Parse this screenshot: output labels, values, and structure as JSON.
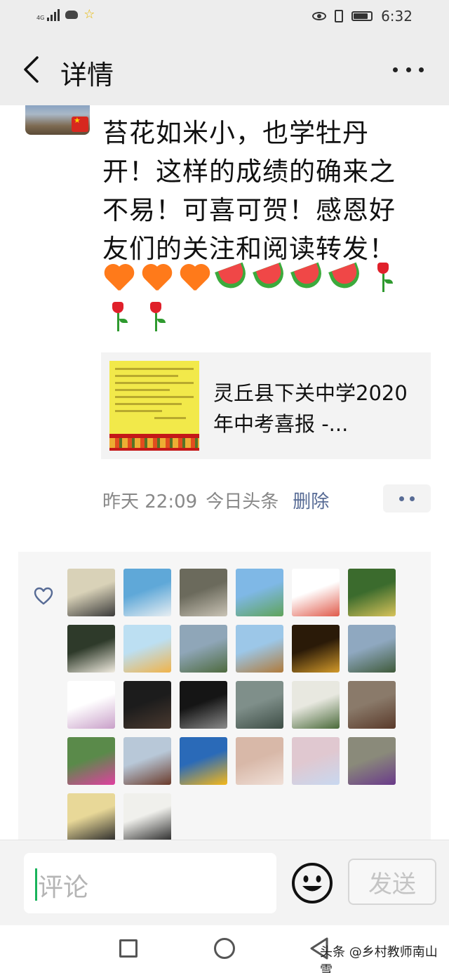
{
  "status_bar": {
    "network": "4G",
    "time": "6:32",
    "battery_level": 0.85
  },
  "header": {
    "title": "详情"
  },
  "post": {
    "text": "苔花如米小，也学牡丹开！这样的成绩的确来之不易！可喜可贺！感恩好友们的关注和阅读转发！",
    "emojis": [
      "heart",
      "heart",
      "heart",
      "watermelon",
      "watermelon",
      "watermelon",
      "watermelon",
      "rose",
      "rose",
      "rose"
    ],
    "link": {
      "title": "灵丘县下关中学2020年中考喜报 -..."
    },
    "meta": {
      "time": "昨天 22:09",
      "source": "今日头条",
      "delete_label": "删除"
    }
  },
  "likes": {
    "avatar_colors": [
      [
        "#d9d2b8",
        "#3a3a3a"
      ],
      [
        "#5fa8d8",
        "#e8eef2"
      ],
      [
        "#6b6a5c",
        "#c9c3b5"
      ],
      [
        "#7fb8e6",
        "#5fa35a"
      ],
      [
        "#ffffff",
        "#e05a4a"
      ],
      [
        "#3b6b2d",
        "#d8c35a"
      ],
      [
        "#2e3a2a",
        "#f1ece0"
      ],
      [
        "#bcdff2",
        "#f0b34a"
      ],
      [
        "#8fa6b8",
        "#4e6a3e"
      ],
      [
        "#9cc7e8",
        "#b07a3a"
      ],
      [
        "#2a1a08",
        "#d39a2a"
      ],
      [
        "#8fa8c0",
        "#3f5a3a"
      ],
      [
        "#ffffff",
        "#c9a0c9"
      ],
      [
        "#1c1c1c",
        "#4a3a30"
      ],
      [
        "#151515",
        "#8a8a8a"
      ],
      [
        "#7f8f8a",
        "#3d4d45"
      ],
      [
        "#e8e8e0",
        "#4a6a3a"
      ],
      [
        "#8a7a6a",
        "#5a3a2a"
      ],
      [
        "#5a8a4a",
        "#e040a0"
      ],
      [
        "#b8c8d8",
        "#6a3a2a"
      ],
      [
        "#2a6ab8",
        "#f5b81a"
      ],
      [
        "#d8b8a8",
        "#f0e0d8"
      ],
      [
        "#e0c8d0",
        "#c8d8f0"
      ],
      [
        "#8a8a7a",
        "#6a3a8a"
      ],
      [
        "#e8d898",
        "#2a2a2a"
      ],
      [
        "#f0f0ec",
        "#2a2a2a"
      ]
    ]
  },
  "comment_bar": {
    "placeholder": "评论",
    "send_label": "发送"
  },
  "watermark": "头条 @乡村教师南山雪"
}
